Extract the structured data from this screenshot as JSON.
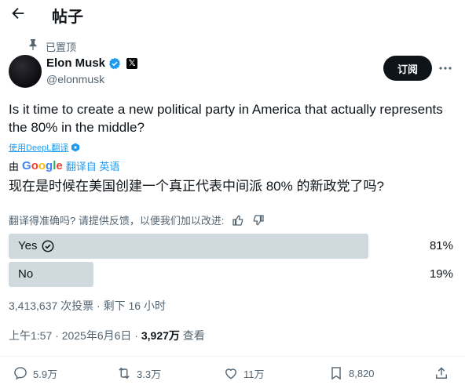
{
  "header": {
    "title": "帖子"
  },
  "pinned": {
    "label": "已置顶"
  },
  "author": {
    "name": "Elon Musk",
    "handle": "@elonmusk",
    "badge_symbol": "𝕏"
  },
  "subscribe_label": "订阅",
  "tweet": {
    "text": "Is it time to create a new political party in America that actually represents the 80% in the middle?"
  },
  "translation": {
    "deepl_link": "使用DeepL翻译",
    "by": "由",
    "google_letters": [
      "G",
      "o",
      "o",
      "g",
      "l",
      "e"
    ],
    "translated_from": "翻译自 英语",
    "text": "现在是时候在美国创建一个真正代表中间派 80% 的新政党了吗?",
    "feedback": "翻译得准确吗? 请提供反馈，以便我们加以改进:"
  },
  "poll": {
    "options": [
      {
        "label": "Yes",
        "percent": "81%",
        "fraction": 0.81,
        "winner": true
      },
      {
        "label": "No",
        "percent": "19%",
        "fraction": 0.19,
        "winner": false
      }
    ],
    "meta": "3,413,637 次投票 · 剩下 16 小时"
  },
  "timestamp": {
    "time": "上午1:57 · 2025年6月6日 · ",
    "views": "3,927万",
    "views_label": " 查看"
  },
  "actions": {
    "replies": "5.9万",
    "reposts": "3.3万",
    "likes": "11万",
    "bookmarks": "8,820"
  },
  "colors": {
    "accent": "#1d9bf0",
    "poll_bar": "#cfd9de",
    "text": "#0f1419",
    "muted": "#536471"
  }
}
